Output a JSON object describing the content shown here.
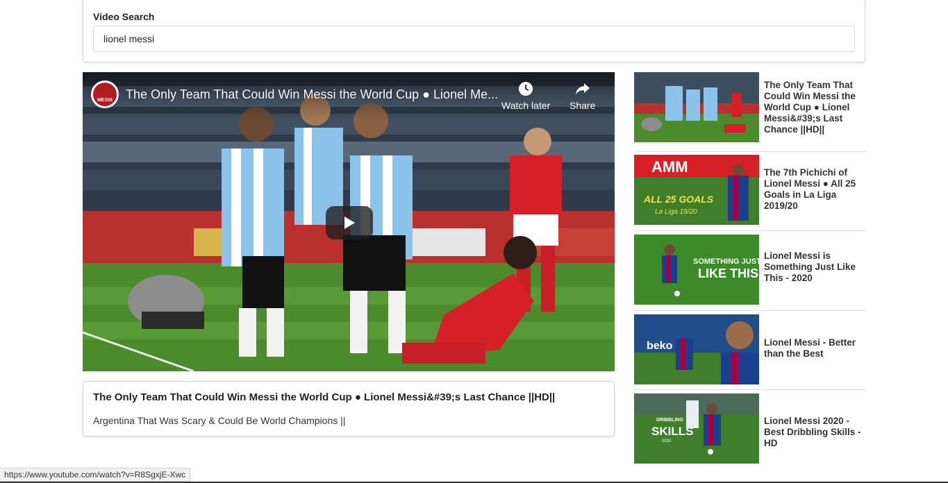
{
  "search": {
    "label": "Video Search",
    "value": "lionel messi"
  },
  "player": {
    "title": "The Only Team That Could Win Messi the World Cup ● Lionel Me...",
    "channel_avatar_text": "MESSI",
    "watch_later_label": "Watch later",
    "share_label": "Share"
  },
  "selected_video": {
    "title": "The Only Team That Could Win Messi the World Cup ● Lionel Messi&#39;s Last Chance ||HD||",
    "description": "Argentina That Was Scary & Could Be World Champions ||"
  },
  "video_list": [
    {
      "title": "The Only Team That Could Win Messi the World Cup ● Lionel Messi&#39;s Last Chance ||HD||"
    },
    {
      "title": "The 7th Pichichi of Lionel Messi ● All 25 Goals in La Liga 2019/20",
      "thumb_text": "ALL 25 GOALS",
      "thumb_sub": "La Liga 19/20",
      "thumb_banner": "AMM"
    },
    {
      "title": "Lionel Messi is Something Just Like This - 2020",
      "thumb_text": "SOMETHING JUST",
      "thumb_text2": "LIKE THIS"
    },
    {
      "title": "Lionel Messi - Better than the Best",
      "thumb_text": "beko"
    },
    {
      "title": "Lionel Messi 2020 - Best Dribbling Skills - HD",
      "thumb_text": "SKILLS",
      "thumb_sub": "DRIBBLING",
      "thumb_year": "2020"
    }
  ],
  "status_bar": {
    "url": "https://www.youtube.com/watch?v=R8SgxjE-Xwc"
  },
  "colors": {
    "argentina_blue": "#8cc3ea",
    "korea_red": "#d71f27",
    "pitch_green": "#3f7f2a",
    "barca_blue": "#1b3f8f"
  }
}
